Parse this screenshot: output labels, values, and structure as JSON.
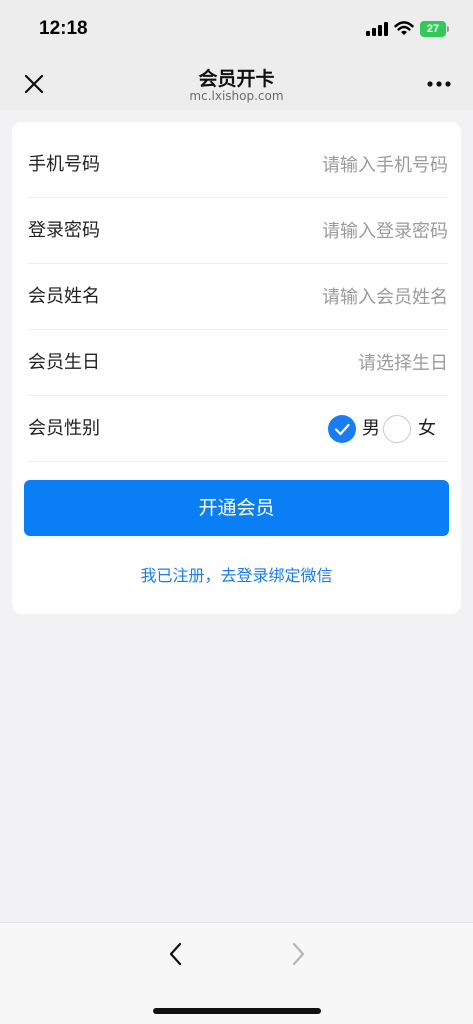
{
  "status_bar": {
    "time": "12:18",
    "battery": "27"
  },
  "nav": {
    "title": "会员开卡",
    "subtitle": "mc.lxishop.com"
  },
  "form": {
    "phone": {
      "label": "手机号码",
      "placeholder": "请输入手机号码"
    },
    "password": {
      "label": "登录密码",
      "placeholder": "请输入登录密码"
    },
    "name": {
      "label": "会员姓名",
      "placeholder": "请输入会员姓名"
    },
    "birthday": {
      "label": "会员生日",
      "placeholder": "请选择生日"
    },
    "gender": {
      "label": "会员性别",
      "options": [
        {
          "label": "男",
          "checked": true
        },
        {
          "label": "女",
          "checked": false
        }
      ]
    }
  },
  "submit_label": "开通会员",
  "login_link": "我已注册，去登录绑定微信",
  "colors": {
    "accent": "#0a7ef5",
    "link": "#1a7cf5",
    "battery": "#34c759"
  }
}
